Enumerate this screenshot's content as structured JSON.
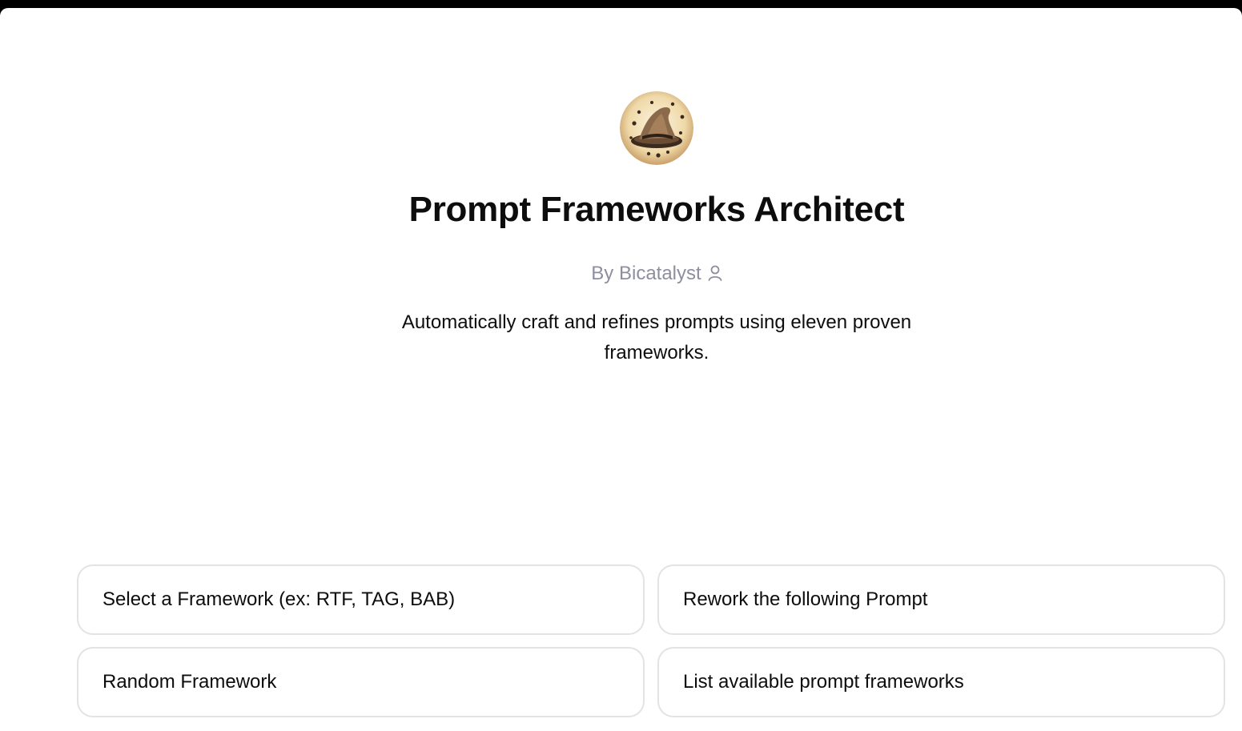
{
  "gpt": {
    "avatar_icon": "wizard-hat-icon",
    "title": "Prompt Frameworks Architect",
    "author": "By Bicatalyst",
    "author_icon": "user-icon",
    "description": "Automatically craft and refines prompts using eleven proven frameworks."
  },
  "conversation_starters": [
    {
      "label": "Select a Framework (ex: RTF, TAG, BAB)"
    },
    {
      "label": "Rework the following Prompt"
    },
    {
      "label": "Random Framework"
    },
    {
      "label": "List available prompt frameworks"
    }
  ],
  "colors": {
    "frame_background": "#000000",
    "page_background": "#ffffff",
    "text_primary": "#0d0d0d",
    "text_secondary": "#8e8ea0",
    "card_border": "#e3e3e3"
  }
}
